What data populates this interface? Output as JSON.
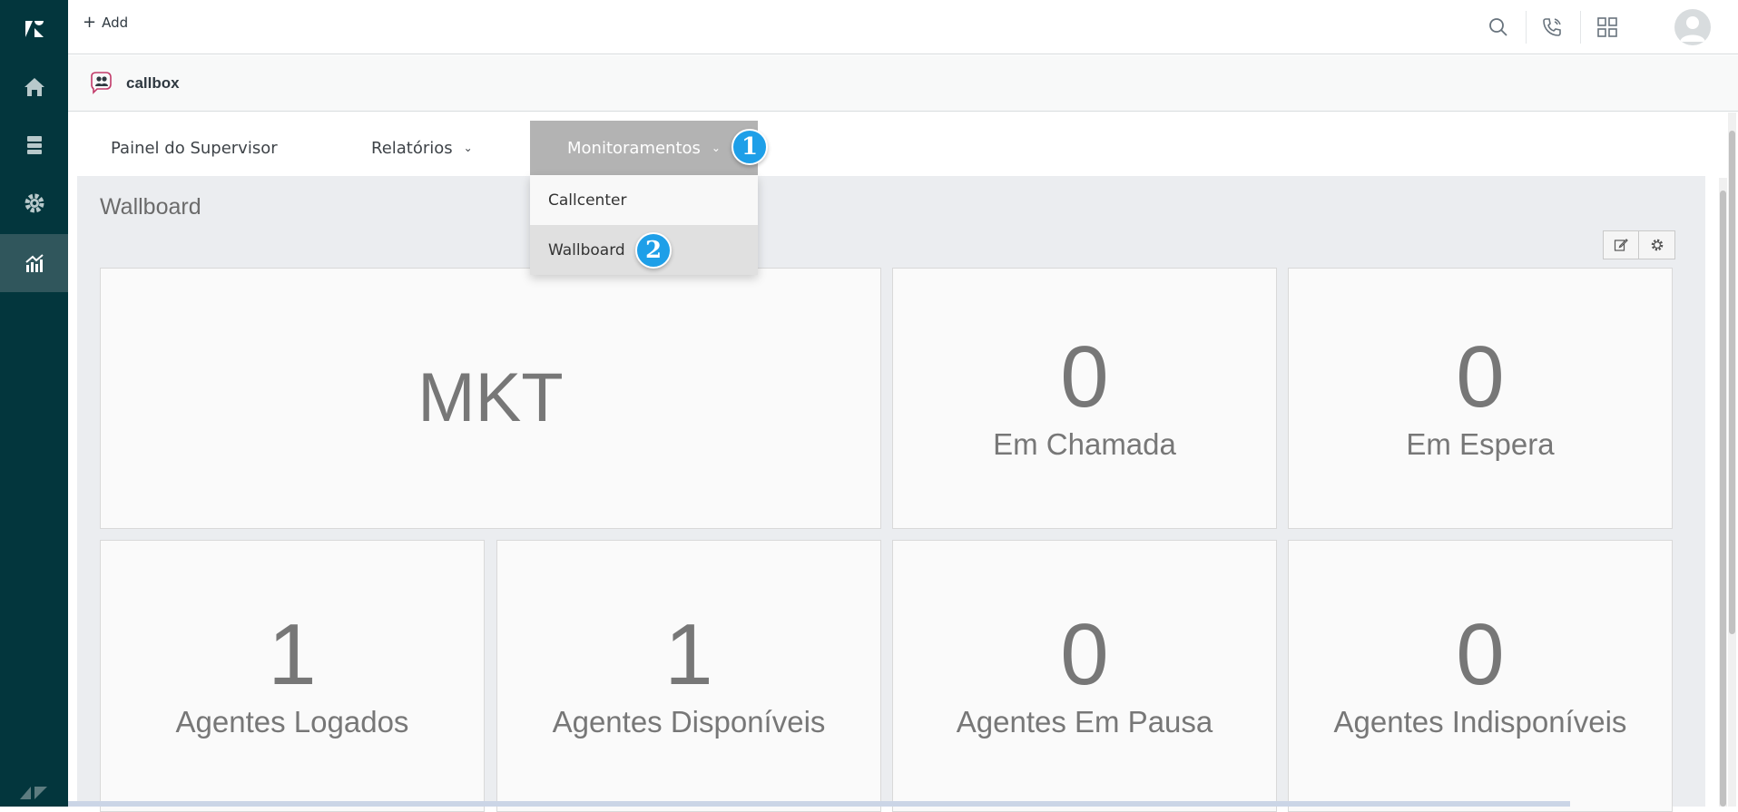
{
  "topbar": {
    "add_label": "Add"
  },
  "rail": {
    "items": [
      {
        "icon": "logo-icon"
      },
      {
        "icon": "home-icon"
      },
      {
        "icon": "views-icon"
      },
      {
        "icon": "settings-icon"
      },
      {
        "icon": "reporting-icon",
        "active": true
      }
    ]
  },
  "app": {
    "name": "callbox"
  },
  "menu": {
    "items": [
      {
        "label": "Painel do Supervisor"
      },
      {
        "label": "Relatórios"
      },
      {
        "label": "Monitoramentos",
        "active": true
      }
    ]
  },
  "dropdown": {
    "items": [
      {
        "label": "Callcenter"
      },
      {
        "label": "Wallboard"
      }
    ]
  },
  "badges": [
    "1",
    "2"
  ],
  "page": {
    "title": "Wallboard"
  },
  "cards": {
    "title_card": "MKT",
    "em_chamada": {
      "value": "0",
      "label": "Em Chamada"
    },
    "em_espera": {
      "value": "0",
      "label": "Em Espera"
    },
    "logados": {
      "value": "1",
      "label": "Agentes Logados"
    },
    "disponiveis": {
      "value": "1",
      "label": "Agentes Disponíveis"
    },
    "pausa": {
      "value": "0",
      "label": "Agentes Em Pausa"
    },
    "indisponiveis": {
      "value": "0",
      "label": "Agentes Indisponíveis"
    }
  },
  "colors": {
    "rail": "#03363d",
    "badge": "#1e9fe8",
    "active_menu": "#b3b3b3"
  }
}
